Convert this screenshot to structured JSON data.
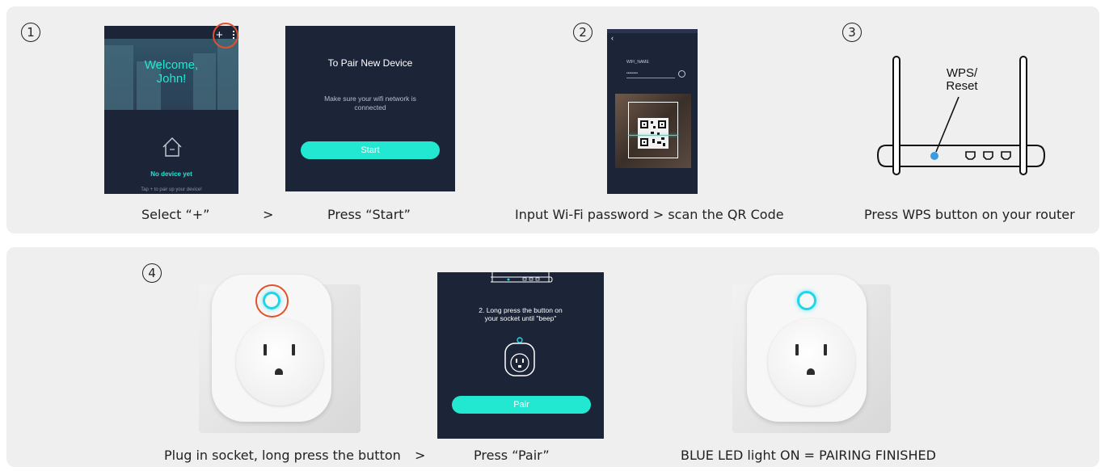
{
  "steps": {
    "one": {
      "num": "1",
      "caption_a": "Select “+”",
      "arrow": ">",
      "caption_b": "Press “Start”"
    },
    "two": {
      "num": "2",
      "caption": "Input Wi-Fi password >  scan the QR Code"
    },
    "three": {
      "num": "3",
      "caption": "Press WPS button on your router",
      "wps_label": "WPS/\nReset"
    },
    "four": {
      "num": "4",
      "caption_a": "Plug in socket, long press the button",
      "arrow": ">",
      "caption_b": "Press “Pair”",
      "caption_c": "BLUE LED light ON = PAIRING FINISHED"
    }
  },
  "screens": {
    "welcome": {
      "greeting": "Welcome,\nJohn!",
      "plus": "+",
      "empty_title": "No device yet",
      "hint": "Tap + to pair up your device!"
    },
    "pair_new": {
      "title": "To Pair New Device",
      "body": "Make sure your wifi network is\nconnected",
      "button": "Start"
    },
    "wifi": {
      "field_label": "WIFI_NAME",
      "password_mask": "••••••••"
    },
    "pair_socket": {
      "instruction": "2. Long press the button on\nyour socket until \"beep\"",
      "button": "Pair"
    }
  },
  "colors": {
    "accent": "#22e8d2",
    "highlight_ring": "#e2512b",
    "led": "#22d4e8",
    "screen_bg": "#1c2438"
  }
}
